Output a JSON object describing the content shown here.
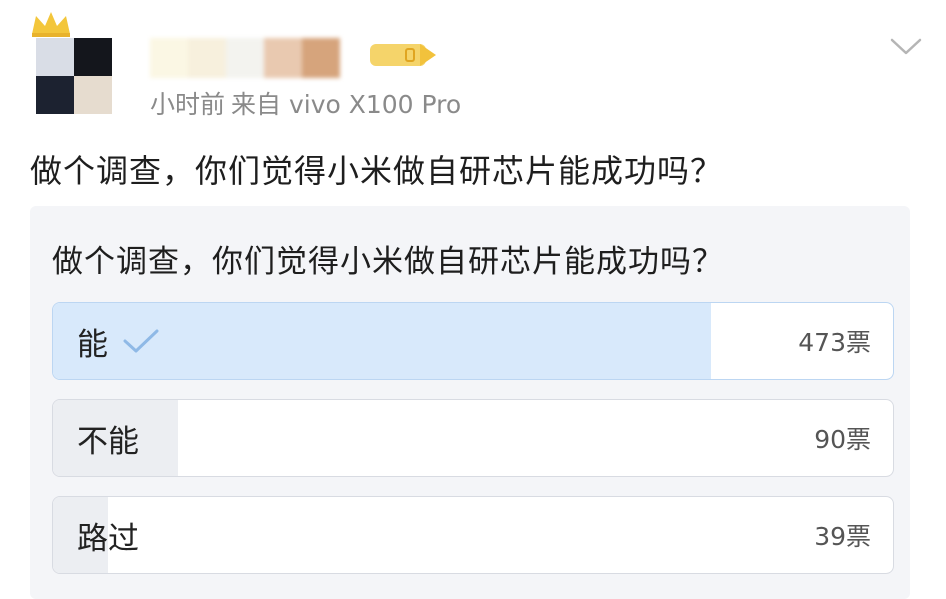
{
  "post": {
    "meta_time": "小时前",
    "meta_source": "来自 vivo X100 Pro",
    "text": "做个调查，你们觉得小米做自研芯片能成功吗？"
  },
  "poll": {
    "title": "做个调查，你们觉得小米做自研芯片能成功吗？",
    "accent_color": "#d8e9fb",
    "options": [
      {
        "label": "能",
        "count": "473票",
        "votes": 473,
        "share": 0.783,
        "selected": true
      },
      {
        "label": "不能",
        "count": "90票",
        "votes": 90,
        "share": 0.149,
        "selected": false
      },
      {
        "label": "路过",
        "count": "39票",
        "votes": 39,
        "share": 0.065,
        "selected": false
      }
    ]
  }
}
